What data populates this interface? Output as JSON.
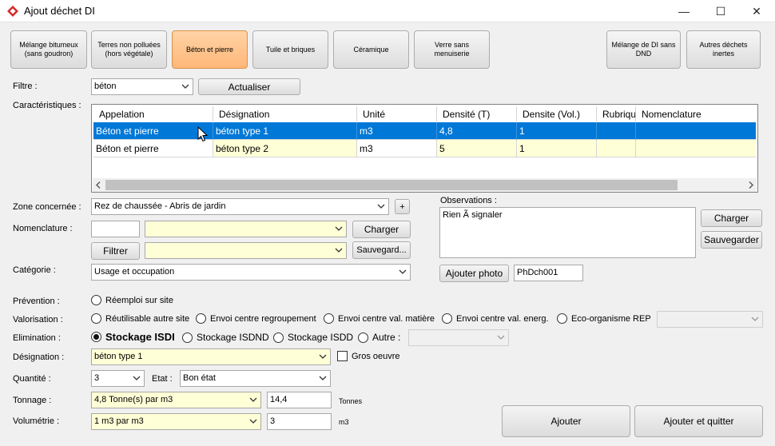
{
  "window": {
    "title": "Ajout déchet DI",
    "minimize": "—",
    "maximize": "☐",
    "close": "✕"
  },
  "categories": [
    {
      "label": "Mélange bitumeux\n(sans goudron)",
      "active": false
    },
    {
      "label": "Terres non polluées\n(hors végétale)",
      "active": false
    },
    {
      "label": "Béton et pierre",
      "active": true
    },
    {
      "label": "Tuile et briques",
      "active": false
    },
    {
      "label": "Céramique",
      "active": false
    },
    {
      "label": "Verre sans\nmenuiserie",
      "active": false
    },
    {
      "label": "Mélange de DI sans\nDND",
      "active": false
    },
    {
      "label": "Autres déchets\ninertes",
      "active": false
    }
  ],
  "filter": {
    "label": "Filtre :",
    "value": "béton",
    "refresh": "Actualiser"
  },
  "characteristics": {
    "label": "Caractéristiques :",
    "columns": [
      "Appelation",
      "Désignation",
      "Unité",
      "Densité (T)",
      "Densite (Vol.)",
      "Rubrique",
      "Nomenclature"
    ],
    "rows": [
      [
        "Béton et pierre",
        "béton type 1",
        "m3",
        "4,8",
        "1",
        "",
        ""
      ],
      [
        "Béton et pierre",
        "béton type 2",
        "m3",
        "5",
        "1",
        "",
        ""
      ]
    ],
    "selected_row": 0
  },
  "zone": {
    "label": "Zone concernée :",
    "value": "Rez de chaussée - Abris de jardin",
    "add": "+"
  },
  "nomenclature": {
    "label": "Nomenclature :",
    "code": "",
    "value": "",
    "charger": "Charger",
    "filter_btn": "Filtrer",
    "filter_value": "",
    "sauvegarder": "Sauvegard..."
  },
  "categorie": {
    "label": "Catégorie :",
    "value": "Usage et occupation"
  },
  "observations": {
    "label": "Observations :",
    "value": "Rien Ã  signaler",
    "charger": "Charger",
    "sauvegarder": "Sauvegarder",
    "photo_btn": "Ajouter photo",
    "photo_id": "PhDch001"
  },
  "prevention": {
    "label": "Prévention :",
    "options": [
      "Réemploi sur site"
    ]
  },
  "valorisation": {
    "label": "Valorisation :",
    "options": [
      "Réutilisable autre site",
      "Envoi centre regroupement",
      "Envoi centre val. matière",
      "Envoi centre val. energ.",
      "Eco-organisme REP"
    ],
    "combo": ""
  },
  "elimination": {
    "label": "Elimination :",
    "options": [
      "Stockage ISDI",
      "Stockage ISDND",
      "Stockage ISDD",
      "Autre :"
    ],
    "selected": 0,
    "combo": ""
  },
  "designation": {
    "label": "Désignation :",
    "value": "béton type 1",
    "gros_oeuvre": "Gros oeuvre"
  },
  "quantite": {
    "label": "Quantité :",
    "value": "3",
    "etat_label": "Etat :",
    "etat": "Bon état"
  },
  "tonnage": {
    "label": "Tonnage :",
    "value": "4,8 Tonne(s) par m3",
    "amount": "14,4",
    "unit": "Tonnes"
  },
  "volumetrie": {
    "label": "Volumétrie :",
    "value": "1 m3 par m3",
    "amount": "3",
    "unit": "m3"
  },
  "actions": {
    "add": "Ajouter",
    "add_quit": "Ajouter et quitter"
  }
}
